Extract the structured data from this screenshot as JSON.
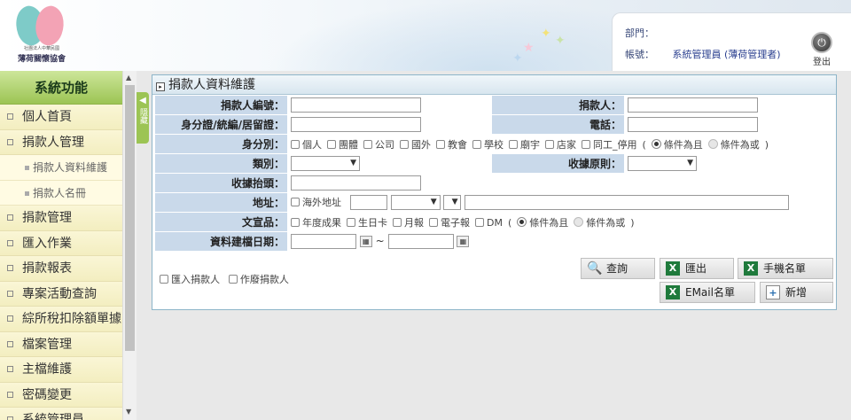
{
  "header": {
    "logo_subtitle": "社團法人中華民國",
    "logo_name": "薄荷關懷協會",
    "dept_label": "部門：",
    "dept_value": "",
    "account_label": "帳號：",
    "account_value": "系統管理員 (薄荷管理者)",
    "logout_label": "登出"
  },
  "sidebar": {
    "title": "系統功能",
    "collapse_label": "隱藏",
    "items": [
      {
        "label": "個人首頁",
        "type": "item"
      },
      {
        "label": "捐款人管理",
        "type": "item"
      },
      {
        "label": "捐款人資料維護",
        "type": "sub"
      },
      {
        "label": "捐款人名冊",
        "type": "sub"
      },
      {
        "label": "捐款管理",
        "type": "item"
      },
      {
        "label": "匯入作業",
        "type": "item"
      },
      {
        "label": "捐款報表",
        "type": "item"
      },
      {
        "label": "專案活動查詢",
        "type": "item"
      },
      {
        "label": "綜所稅扣除額單據",
        "type": "item"
      },
      {
        "label": "檔案管理",
        "type": "item"
      },
      {
        "label": "主檔維護",
        "type": "item"
      },
      {
        "label": "密碼變更",
        "type": "item"
      },
      {
        "label": "系統管理員",
        "type": "item"
      }
    ]
  },
  "panel": {
    "title": "捐款人資料維護",
    "fields": {
      "donor_no": "捐款人編號：",
      "donor": "捐款人：",
      "id_no": "身分證/統編/居留證：",
      "phone": "電話：",
      "identity": "身分別：",
      "category": "類別：",
      "receipt_rule": "收據原則：",
      "receipt_title": "收據抬頭：",
      "address": "地址：",
      "promo": "文宣品：",
      "created_date": "資料建檔日期："
    },
    "identity_options": [
      "個人",
      "團體",
      "公司",
      "國外",
      "教會",
      "學校",
      "廟宇",
      "店家",
      "同工_停用"
    ],
    "promo_options": [
      "年度成果",
      "生日卡",
      "月報",
      "電子報",
      "DM"
    ],
    "cond_and": "條件為且",
    "cond_or": "條件為或",
    "overseas_label": "海外地址",
    "date_sep": "~",
    "paren_open": "(",
    "paren_close": ")"
  },
  "actions": {
    "import_donor": "匯入捐款人",
    "void_donor": "作廢捐款人",
    "query": "查詢",
    "export": "匯出",
    "mobile_list": "手機名單",
    "email_list": "EMail名單",
    "add": "新增"
  }
}
